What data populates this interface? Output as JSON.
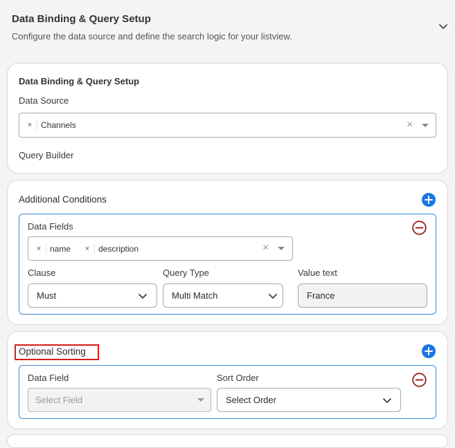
{
  "header": {
    "title": "Data Binding & Query Setup",
    "subtitle": "Configure the data source and define the search logic for your listview."
  },
  "binding": {
    "title": "Data Binding & Query Setup",
    "data_source_label": "Data Source",
    "data_source_tags": [
      "Channels"
    ],
    "query_builder_label": "Query Builder"
  },
  "conditions": {
    "title": "Additional Conditions",
    "data_fields_label": "Data Fields",
    "data_field_tags": [
      "name",
      "description"
    ],
    "clause_label": "Clause",
    "clause_value": "Must",
    "query_type_label": "Query Type",
    "query_type_value": "Multi Match",
    "value_text_label": "Value text",
    "value_text_value": "France"
  },
  "sorting": {
    "title": "Optional Sorting",
    "data_field_label": "Data Field",
    "data_field_placeholder": "Select Field",
    "sort_order_label": "Sort Order",
    "sort_order_value": "Select Order"
  },
  "colors": {
    "accent_blue": "#1877e6",
    "remove_red": "#a02020",
    "highlight_red": "#d81b1b",
    "panel_border": "#3a8ad6"
  },
  "icons": {
    "collapse": "chevron-up-icon",
    "add": "plus-circle-icon",
    "remove": "minus-circle-icon",
    "tag_remove": "close-icon",
    "clear": "clear-icon",
    "dropdown": "caret-down-icon"
  }
}
